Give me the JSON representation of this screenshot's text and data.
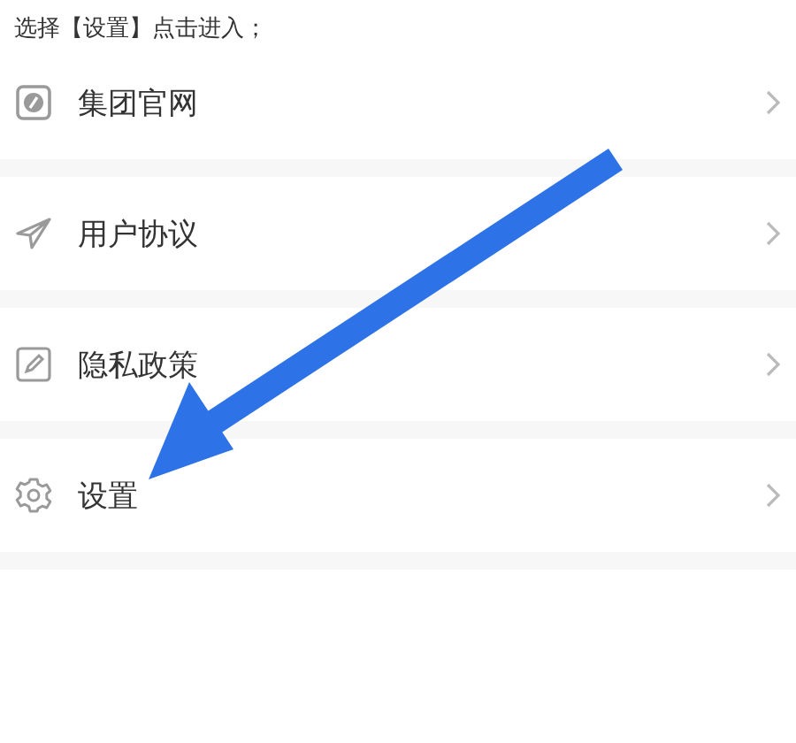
{
  "caption": "选择【设置】点击进入；",
  "menu": [
    {
      "label": "集团官网"
    },
    {
      "label": "用户协议"
    },
    {
      "label": "隐私政策"
    },
    {
      "label": "设置"
    }
  ]
}
